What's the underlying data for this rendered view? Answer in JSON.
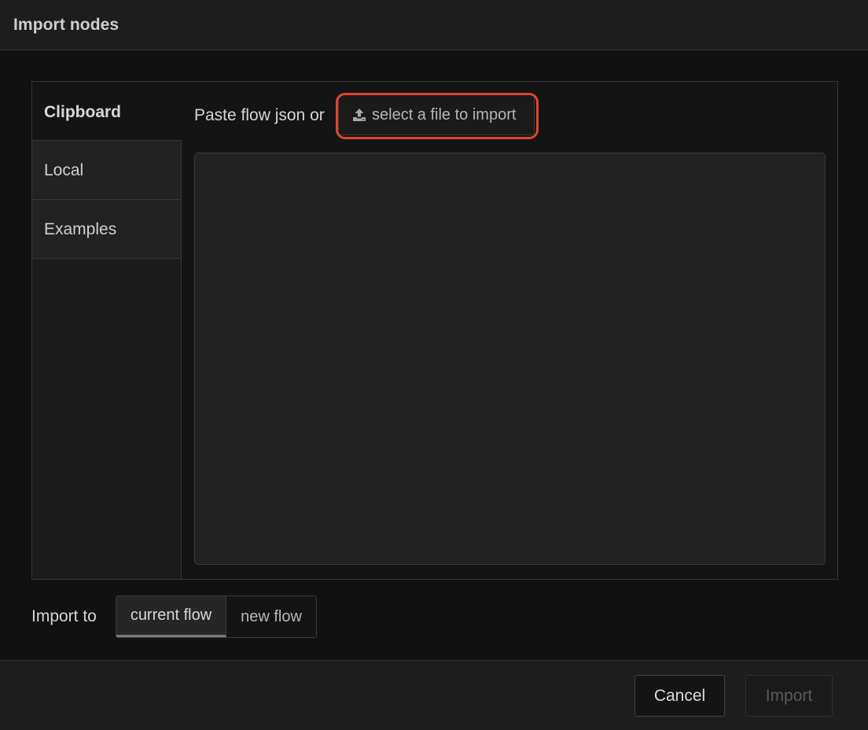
{
  "dialog": {
    "title": "Import nodes"
  },
  "tabs": [
    {
      "label": "Clipboard",
      "active": true
    },
    {
      "label": "Local",
      "active": false
    },
    {
      "label": "Examples",
      "active": false
    }
  ],
  "clipboard": {
    "paste_label": "Paste flow json or",
    "file_button_label": "select a file to import",
    "file_button_icon": "upload-icon",
    "json_value": ""
  },
  "import_to": {
    "label": "Import to",
    "options": [
      {
        "label": "current flow",
        "selected": true
      },
      {
        "label": "new flow",
        "selected": false
      }
    ]
  },
  "footer": {
    "cancel_label": "Cancel",
    "import_label": "Import"
  },
  "colors": {
    "highlight": "#e04431",
    "background": "#111111",
    "panel": "#1d1d1d"
  }
}
